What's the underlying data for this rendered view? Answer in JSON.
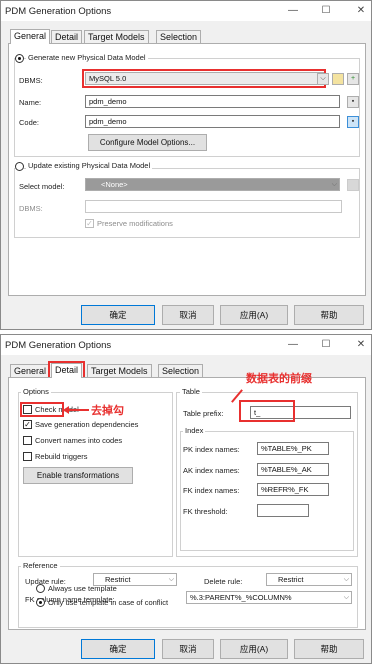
{
  "window_top": {
    "title": "PDM Generation Options",
    "tabs": [
      "General",
      "Detail",
      "Target Models",
      "Selection"
    ],
    "generate_new_label": "Generate new Physical Data Model",
    "dbms_label": "DBMS:",
    "dbms_value": "MySQL 5.0",
    "name_label": "Name:",
    "name_value": "pdm_demo",
    "code_label": "Code:",
    "code_value": "pdm_demo",
    "configure_button": "Configure Model Options...",
    "update_existing_label": "Update existing Physical Data Model",
    "select_model_label": "Select model:",
    "select_model_value": "<None>",
    "dbms2_label": "DBMS:",
    "preserve_label": "Preserve modifications",
    "buttons": [
      "确定",
      "取消",
      "应用(A)",
      "帮助"
    ]
  },
  "window_bottom": {
    "title": "PDM Generation Options",
    "tabs": [
      "General",
      "Detail",
      "Target Models",
      "Selection"
    ],
    "options_group": "Options",
    "check_model": "Check model",
    "save_deps": "Save generation dependencies",
    "convert_names": "Convert names into codes",
    "rebuild_triggers": "Rebuild triggers",
    "enable_transformations": "Enable transformations",
    "table_group": "Table",
    "table_prefix_label": "Table prefix:",
    "table_prefix_value": "t_",
    "index_group": "Index",
    "pk_label": "PK index names:",
    "pk_value": "%TABLE%_PK",
    "ak_label": "AK index names:",
    "ak_value": "%TABLE%_AK",
    "fk_label": "FK index names:",
    "fk_value": "%REFR%_FK",
    "fk_threshold_label": "FK threshold:",
    "reference_group": "Reference",
    "update_rule_label": "Update rule:",
    "update_rule_value": "Restrict",
    "delete_rule_label": "Delete rule:",
    "delete_rule_value": "Restrict",
    "fk_template_label": "FK column name template:",
    "fk_template_value": "%.3:PARENT%_%COLUMN%",
    "always_template": "Always use template",
    "only_template": "Only use template in case of conflict",
    "buttons": [
      "确定",
      "取消",
      "应用(A)",
      "帮助"
    ]
  },
  "annotations": {
    "uncheck": "去掉勾",
    "table_prefix": "数据表的前缀"
  },
  "icons": {
    "minimize": "—",
    "maximize": "☐",
    "close": "✕",
    "dropdown": "⌵",
    "more": "▪",
    "check": "✓"
  },
  "colors": {
    "highlight": "#e8302f",
    "default_button": "#0078d7"
  }
}
